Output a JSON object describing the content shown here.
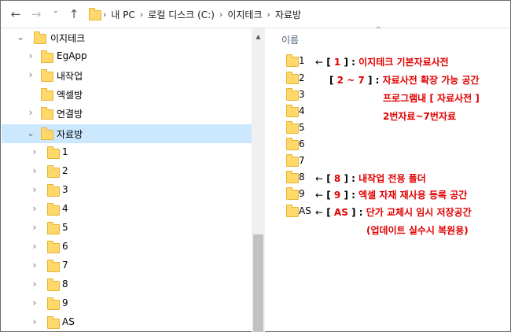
{
  "address": {
    "crumbs": [
      "내 PC",
      "로컬 디스크 (C:)",
      "이지테크",
      "자료방"
    ]
  },
  "tree": {
    "root": "이지테크",
    "items": [
      {
        "label": "EgApp"
      },
      {
        "label": "내작업"
      },
      {
        "label": "엑셀방"
      },
      {
        "label": "연결방"
      },
      {
        "label": "자료방"
      }
    ],
    "sub_items": [
      "1",
      "2",
      "3",
      "4",
      "5",
      "6",
      "7",
      "8",
      "9",
      "AS"
    ]
  },
  "content": {
    "column_header": "이름",
    "folders": [
      "1",
      "2",
      "3",
      "4",
      "5",
      "6",
      "7",
      "8",
      "9",
      "AS"
    ]
  },
  "annotations": {
    "arrow": "←",
    "a1_num": "1",
    "a1_text": "이지테크 기본자료사전",
    "a2_num": "2 ~ 7",
    "a2_text": "자료사전 확장 가능 공간",
    "a2_line2": "프로그램내 [ 자료사전 ]",
    "a2_line3": "2번자료~7번자료",
    "a8_num": "8",
    "a8_text": "내작업 전용 폴더",
    "a9_num": "9",
    "a9_text": "엑셀 자재 재사용 등록 공간",
    "as_num": "AS",
    "as_text": "단가 교체시 임시 저장공간",
    "as_line2": "(업데이트 실수시 복원용)"
  },
  "colors": {
    "accent_red": "#e00000",
    "selection": "#cce8ff",
    "folder_yellow": "#ffd86b"
  }
}
